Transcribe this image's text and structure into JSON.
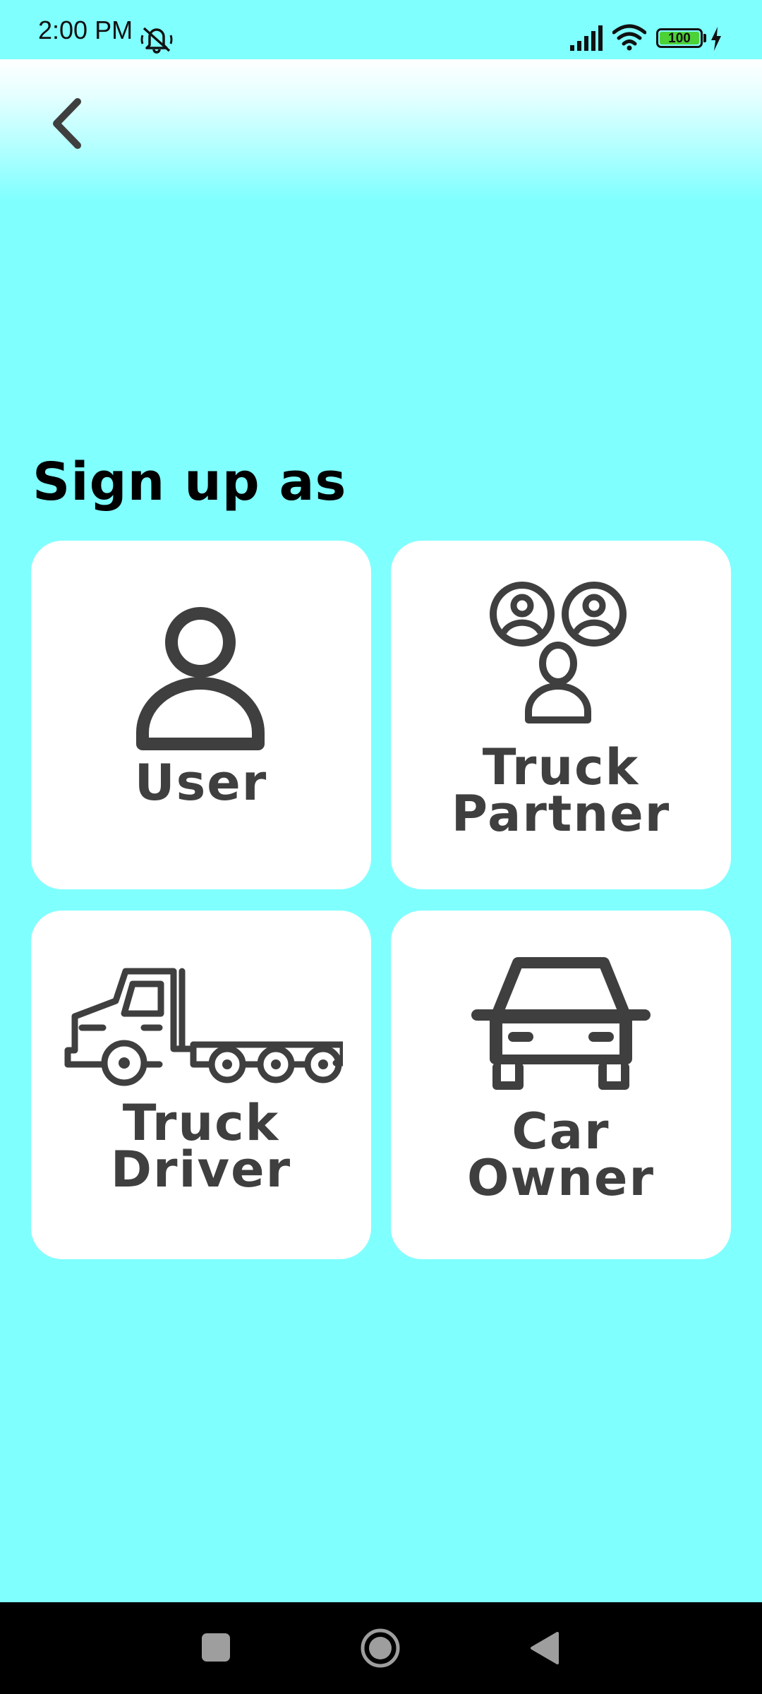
{
  "status_bar": {
    "time": "2:00 PM",
    "battery": "100",
    "icons": [
      "bell-off-icon",
      "signal-icon",
      "wifi-icon",
      "battery-icon",
      "charging-icon"
    ]
  },
  "header": {
    "back_icon": "chevron-left-icon"
  },
  "title": "Sign up as",
  "cards": [
    {
      "id": "user",
      "line1": "User",
      "line2": "",
      "icon": "person-icon"
    },
    {
      "id": "truck-partner",
      "line1": "Truck",
      "line2": "Partner",
      "icon": "partners-icon"
    },
    {
      "id": "truck-driver",
      "line1": "Truck",
      "line2": "Driver",
      "icon": "truck-icon"
    },
    {
      "id": "car-owner",
      "line1": "Car",
      "line2": "Owner",
      "icon": "car-icon"
    }
  ],
  "nav_bar": {
    "icons": [
      "recents-icon",
      "home-icon",
      "back-icon"
    ]
  },
  "colors": {
    "background": "#80FFFF",
    "card": "#FFFFFF",
    "text": "#3F3F3F",
    "title": "#000000",
    "battery_fill": "#4CD137"
  }
}
